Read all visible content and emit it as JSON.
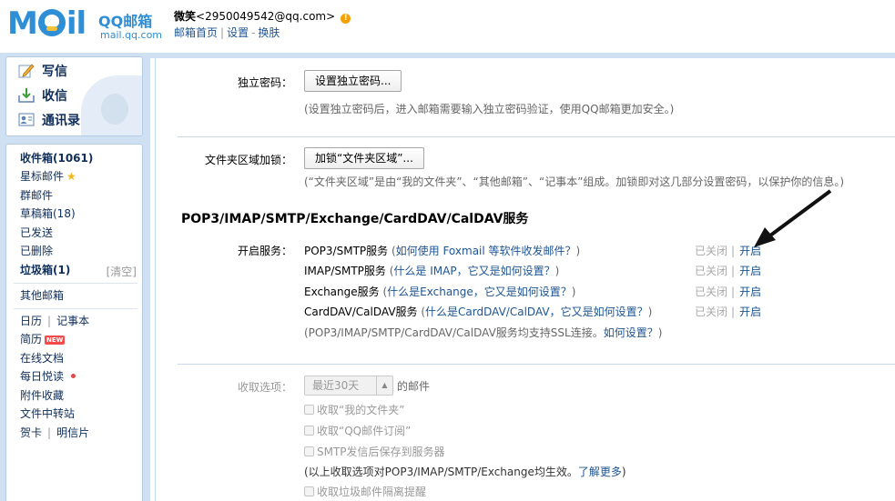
{
  "header": {
    "logo_text": "M",
    "logo_text2": "il",
    "logo_brand": "QQ邮箱",
    "logo_domain": "mail.qq.com",
    "user_name": "微笑",
    "user_email": "<2950049542@qq.com>",
    "links": [
      "邮箱首页",
      "设置",
      "换肤"
    ]
  },
  "quick_actions": [
    {
      "label": "写信",
      "icon": "pencil-icon"
    },
    {
      "label": "收信",
      "icon": "inbox-download-icon"
    },
    {
      "label": "通讯录",
      "icon": "contacts-icon"
    }
  ],
  "folders": {
    "inbox": "收件箱(1061)",
    "starred": "星标邮件",
    "group": "群邮件",
    "drafts": "草稿箱(18)",
    "sent": "已发送",
    "deleted": "已删除",
    "spam": "垃圾箱(1)",
    "spam_clear": "[清空]",
    "other": "其他邮箱",
    "calendar": "日历",
    "notepad": "记事本",
    "resume": "简历",
    "new_badge": "NEW",
    "online_docs": "在线文档",
    "daily_read": "每日悦读",
    "attachments": "附件收藏",
    "file_transfer": "文件中转站",
    "card": "贺卡",
    "postcard": "明信片"
  },
  "settings": {
    "password_label": "独立密码：",
    "password_button": "设置独立密码...",
    "password_hint": "(设置独立密码后，进入邮箱需要输入独立密码验证，使用QQ邮箱更加安全。)",
    "folder_lock_label": "文件夹区域加锁：",
    "folder_lock_button": "加锁“文件夹区域”...",
    "folder_lock_hint": "(“文件夹区域”是由“我的文件夹”、“其他邮箱”、“记事本”组成。加锁即对这几部分设置密码，以保护你的信息。)",
    "section_title": "POP3/IMAP/SMTP/Exchange/CardDAV/CalDAV服务",
    "enable_label": "开启服务：",
    "services": [
      {
        "name": "POP3/SMTP服务",
        "paren_open": " (",
        "help": "如何使用 Foxmail 等软件收发邮件？",
        "paren_close": ")",
        "status": "已关闭",
        "action": "开启"
      },
      {
        "name": "IMAP/SMTP服务",
        "paren_open": " (",
        "help": "什么是 IMAP，它又是如何设置？",
        "paren_close": ")",
        "status": "已关闭",
        "action": "开启"
      },
      {
        "name": "Exchange服务",
        "paren_open": " (",
        "help": "什么是Exchange，它又是如何设置？",
        "paren_close": ")",
        "status": "已关闭",
        "action": "开启"
      },
      {
        "name": "CardDAV/CalDAV服务",
        "paren_open": " (",
        "help": "什么是CardDAV/CalDAV，它又是如何设置？",
        "paren_close": ")",
        "status": "已关闭",
        "action": "开启"
      }
    ],
    "ssl_hint_text": "(POP3/IMAP/SMTP/CardDAV/CalDAV服务均支持SSL连接。",
    "ssl_hint_link": "如何设置？",
    "ssl_hint_close": ")",
    "receive_label": "收取选项：",
    "receive_select": "最近30天",
    "receive_suffix": "的邮件",
    "checkboxes": [
      "收取“我的文件夹”",
      "收取“QQ邮件订阅”",
      "SMTP发信后保存到服务器"
    ],
    "receive_hint_text": "(以上收取选项对POP3/IMAP/SMTP/Exchange均生效。",
    "receive_hint_link": "了解更多",
    "receive_hint_close": ")",
    "spam_checkbox": "收取垃圾邮件隔离提醒"
  },
  "colors": {
    "brand_blue": "#2e8ed6",
    "frame_blue": "#cfe0f3",
    "link_blue": "#1e5494"
  }
}
